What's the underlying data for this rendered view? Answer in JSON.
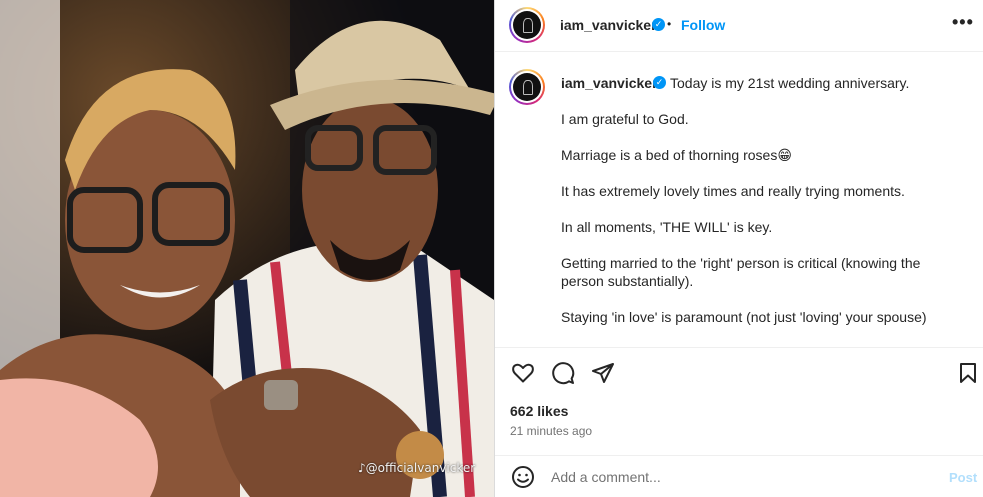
{
  "photo": {
    "watermark": "@officialvanvicker"
  },
  "header": {
    "username": "iam_vanvicker",
    "follow_label": "Follow",
    "separator": "•"
  },
  "caption": {
    "username": "iam_vanvicker",
    "lines": [
      "Today is my 21st wedding anniversary.",
      "I am grateful to God.",
      "Marriage is a bed of thorning roses😁",
      "It has extremely lovely times and really trying moments.",
      "In all moments, 'THE WILL' is key.",
      "Getting married to the 'right' person is critical (knowing the",
      "person substantially).",
      "Staying 'in love' is paramount (not just 'loving' your spouse)"
    ]
  },
  "stats": {
    "likes": "662 likes",
    "time": "21 minutes ago"
  },
  "comment": {
    "placeholder": "Add a comment...",
    "post_label": "Post"
  },
  "icons": [
    "heart-icon",
    "comment-icon",
    "share-icon",
    "bookmark-icon",
    "more-icon",
    "emoji-icon",
    "verified-icon",
    "tiktok-icon"
  ],
  "colors": {
    "follow": "#0095f6",
    "post_disabled": "#b2dffc",
    "verified": "#0095f6"
  }
}
